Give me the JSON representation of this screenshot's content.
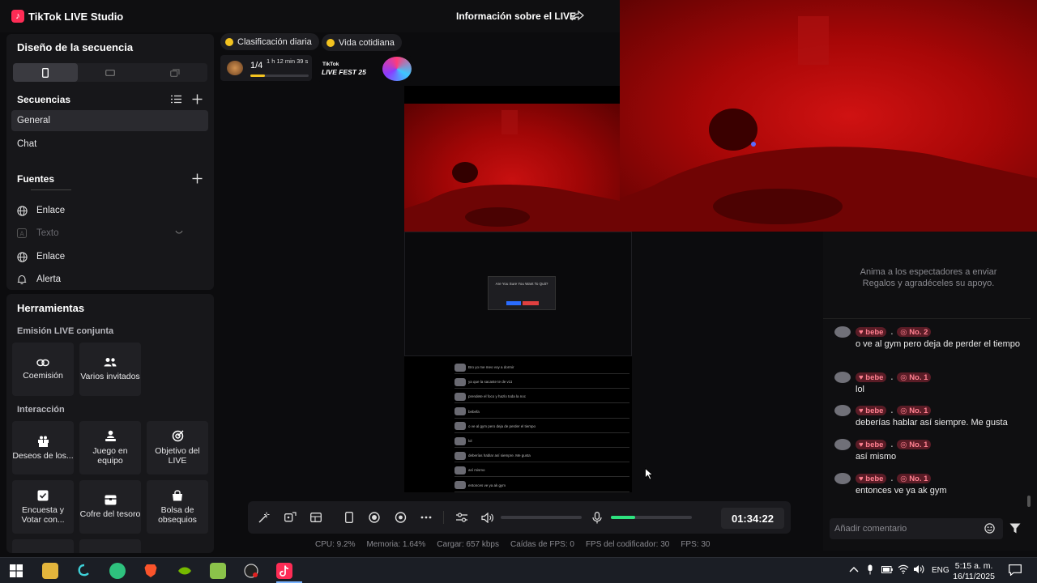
{
  "app": {
    "title": "TikTok LIVE Studio",
    "live_info": "Información sobre el LIVE"
  },
  "design": {
    "title": "Diseño de la secuencia",
    "sequences_title": "Secuencias",
    "sequences": [
      {
        "label": "General",
        "active": true
      },
      {
        "label": "Chat",
        "active": false
      }
    ],
    "sources_title": "Fuentes",
    "sources": [
      {
        "label": "Enlace",
        "icon": "globe-icon",
        "enabled": true
      },
      {
        "label": "Texto",
        "icon": "text-icon",
        "enabled": false
      },
      {
        "label": "Enlace",
        "icon": "globe-icon",
        "enabled": true
      },
      {
        "label": "Alerta",
        "icon": "bell-icon",
        "enabled": true
      }
    ]
  },
  "tools": {
    "title": "Herramientas",
    "cohost_title": "Emisión LIVE conjunta",
    "cohost": [
      {
        "label": "Coemisión",
        "icon": "link-icon"
      },
      {
        "label": "Varios invitados",
        "icon": "users-icon"
      }
    ],
    "interaction_title": "Interacción",
    "interaction": [
      {
        "label": "Deseos de los...",
        "icon": "gift-wish-icon"
      },
      {
        "label": "Juego en equipo",
        "icon": "team-icon"
      },
      {
        "label": "Objetivo del LIVE",
        "icon": "target-icon"
      },
      {
        "label": "Encuesta y Votar con...",
        "icon": "poll-icon"
      },
      {
        "label": "Cofre del tesoro",
        "icon": "chest-icon"
      },
      {
        "label": "Bolsa de obsequios",
        "icon": "bag-icon"
      }
    ]
  },
  "top": {
    "ranking_label": "Clasificación diaria",
    "category_label": "Vida cotidiana",
    "progress_text": "1/4",
    "progress_time": "1 h 12 min 39 s",
    "progress_value": 0.25,
    "fest_line1": "TikTok",
    "fest_line2": "LIVE FEST 25"
  },
  "chat": {
    "promo": "Anima a los espectadores a enviar Regalos y agradéceles su apoyo.",
    "comments": [
      {
        "user": "bebe",
        "rank": "No. 2",
        "text": "o ve al gym pero deja de perder el tiempo"
      },
      {
        "user": "bebe",
        "rank": "No. 1",
        "text": "lol"
      },
      {
        "user": "bebe",
        "rank": "No. 1",
        "text": "deberías hablar así siempre. Me gusta"
      },
      {
        "user": "bebe",
        "rank": "No. 1",
        "text": "así mismo"
      },
      {
        "user": "bebe",
        "rank": "No. 1",
        "text": "entonces ve ya ak gym"
      }
    ],
    "input_placeholder": "Añadir comentario"
  },
  "capture": {
    "dialog_title": "Are You Sure You Want To Quit?",
    "lines": [
      "Bro yo me meo voy a dormir",
      "ya que la sacaste te de v11",
      "prendete el foco y hazlo toda la noc",
      "bebefa",
      "o ve al gym pero deja de perder el tiempo",
      "lol",
      "deberías hablar así siempre. Me gusta",
      "así mismo",
      "entonces ve ya ak gym"
    ]
  },
  "controls": {
    "timer": "01:34:22",
    "volume_level": 0.0,
    "mic_level": 0.3
  },
  "stats": {
    "cpu": "CPU: 9.2%",
    "memory": "Memoria: 1.64%",
    "upload": "Cargar: 657 kbps",
    "fps_drops": "Caídas de FPS: 0",
    "encoder_fps": "FPS del codificador: 30",
    "fps": "FPS: 30"
  },
  "taskbar": {
    "lang": "ENG",
    "time": "5:15 a. m.",
    "date": "16/11/2025"
  },
  "colors": {
    "accent": "#fe2c55",
    "mic_green": "#2ee27f",
    "coin": "#f3c320"
  }
}
